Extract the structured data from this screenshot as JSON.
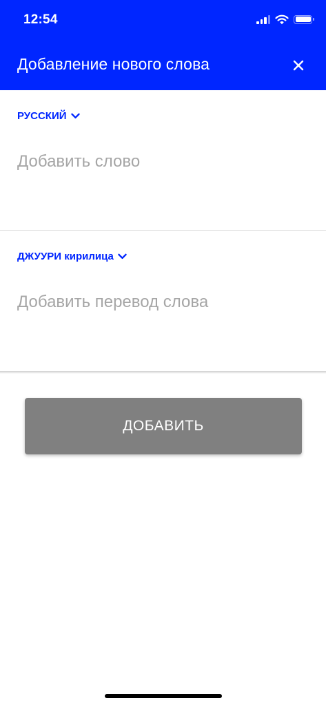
{
  "status_bar": {
    "time": "12:54"
  },
  "header": {
    "title": "Добавление нового слова",
    "close_icon": "close-icon",
    "background_color": "#0026ff"
  },
  "source": {
    "language_label": "РУССКИЙ",
    "input_placeholder": "Добавить слово",
    "input_value": ""
  },
  "target": {
    "language_label": "ДЖУУРИ кирилица",
    "input_placeholder": "Добавить перевод слова",
    "input_value": ""
  },
  "add_button": {
    "label": "ДОБАВИТЬ",
    "color": "#808080"
  },
  "colors": {
    "accent": "#0026ff",
    "placeholder": "#a6a6a6"
  }
}
